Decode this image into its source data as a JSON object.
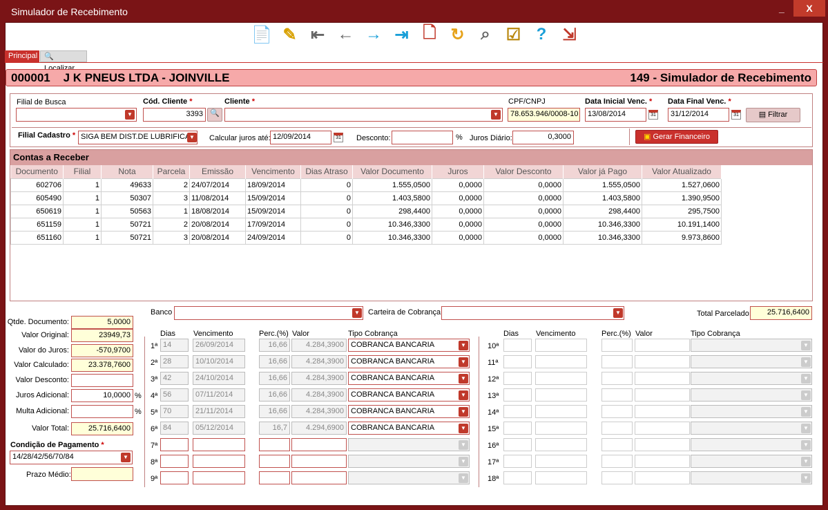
{
  "window": {
    "title": "Simulador de Recebimento",
    "minimize": "_",
    "close": "X"
  },
  "toolbar": [
    {
      "name": "new-icon"
    },
    {
      "name": "edit-icon"
    },
    {
      "name": "first-record-icon"
    },
    {
      "name": "previous-record-icon"
    },
    {
      "name": "next-record-icon"
    },
    {
      "name": "last-record-icon"
    },
    {
      "name": "delete-icon"
    },
    {
      "name": "refresh-icon"
    },
    {
      "name": "search-icon"
    },
    {
      "name": "checklist-icon"
    },
    {
      "name": "help-icon"
    },
    {
      "name": "exit-icon"
    }
  ],
  "tabs": {
    "principal": "Principal",
    "localizar": "Localizar"
  },
  "header": {
    "company": "000001    J K PNEUS LTDA - JOINVILLE",
    "module": "149 - Simulador de Recebimento"
  },
  "filters": {
    "filial_busca_label": "Filial de Busca",
    "filial_busca_value": "",
    "cod_cliente_label": "Cód. Cliente",
    "cod_cliente_value": "3393",
    "cliente_label": "Cliente",
    "cliente_value": "",
    "cpf_label": "CPF/CNPJ",
    "cpf_value": "78.653.946/0008-10",
    "data_inicial_label": "Data Inicial Venc.",
    "data_inicial_value": "13/08/2014",
    "data_final_label": "Data Final Venc.",
    "data_final_value": "31/12/2014",
    "filtrar": "Filtrar",
    "filial_cadastro_label": "Filial Cadastro",
    "filial_cadastro_value": "SIGA BEM DIST.DE LUBRIFICANT",
    "calcular_juros_label": "Calcular juros até:",
    "calcular_juros_value": "12/09/2014",
    "desconto_label": "Desconto:",
    "desconto_value": "",
    "percent": "%",
    "juros_diario_label": "Juros Diário:",
    "juros_diario_value": "0,3000",
    "gerar": "Gerar Financeiro",
    "required_mark": "*"
  },
  "contas": {
    "title": "Contas a Receber",
    "columns": [
      "Documento",
      "Filial",
      "Nota",
      "Parcela",
      "Emissão",
      "Vencimento",
      "Dias Atraso",
      "Valor Documento",
      "Juros",
      "Valor Desconto",
      "Valor já Pago",
      "Valor Atualizado"
    ],
    "rows": [
      [
        "602706",
        "1",
        "49633",
        "2",
        "24/07/2014",
        "18/09/2014",
        "0",
        "1.555,0500",
        "0,0000",
        "0,0000",
        "1.555,0500",
        "1.527,0600"
      ],
      [
        "605490",
        "1",
        "50307",
        "3",
        "11/08/2014",
        "15/09/2014",
        "0",
        "1.403,5800",
        "0,0000",
        "0,0000",
        "1.403,5800",
        "1.390,9500"
      ],
      [
        "650619",
        "1",
        "50563",
        "1",
        "18/08/2014",
        "15/09/2014",
        "0",
        "298,4400",
        "0,0000",
        "0,0000",
        "298,4400",
        "295,7500"
      ],
      [
        "651159",
        "1",
        "50721",
        "2",
        "20/08/2014",
        "17/09/2014",
        "0",
        "10.346,3300",
        "0,0000",
        "0,0000",
        "10.346,3300",
        "10.191,1400"
      ],
      [
        "651160",
        "1",
        "50721",
        "3",
        "20/08/2014",
        "24/09/2014",
        "0",
        "10.346,3300",
        "0,0000",
        "0,0000",
        "10.346,3300",
        "9.973,8600"
      ]
    ]
  },
  "summary": {
    "qtde_label": "Qtde. Documento:",
    "qtde_value": "5,0000",
    "valor_original_label": "Valor Original:",
    "valor_original_value": "23949,73",
    "valor_juros_label": "Valor do Juros:",
    "valor_juros_value": "-570,9700",
    "valor_calculado_label": "Valor Calculado:",
    "valor_calculado_value": "23.378,7600",
    "valor_desconto_label": "Valor Desconto:",
    "valor_desconto_value": "",
    "juros_adicional_label": "Juros Adicional:",
    "juros_adicional_value": "10,0000",
    "multa_adicional_label": "Multa Adicional:",
    "multa_adicional_value": "",
    "valor_total_label": "Valor Total:",
    "valor_total_value": "25.716,6400",
    "condicao_label": "Condição de Pagamento",
    "condicao_value": "14/28/42/56/70/84",
    "prazo_label": "Prazo Médio:",
    "prazo_value": "",
    "percent": "%"
  },
  "parcelas": {
    "banco_label": "Banco",
    "banco_value": "",
    "carteira_label": "Carteira de Cobrança",
    "carteira_value": "",
    "total_parcelado_label": "Total Parcelado:",
    "total_parcelado_value": "25.716,6400",
    "headers": {
      "dias": "Dias",
      "vencimento": "Vencimento",
      "perc": "Perc.(%)",
      "valor": "Valor",
      "tipo": "Tipo Cobrança"
    },
    "left": [
      {
        "n": "1ª",
        "dias": "14",
        "venc": "26/09/2014",
        "perc": "16,66",
        "valor": "4.284,3900",
        "tipo": "COBRANCA BANCARIA"
      },
      {
        "n": "2ª",
        "dias": "28",
        "venc": "10/10/2014",
        "perc": "16,66",
        "valor": "4.284,3900",
        "tipo": "COBRANCA BANCARIA"
      },
      {
        "n": "3ª",
        "dias": "42",
        "venc": "24/10/2014",
        "perc": "16,66",
        "valor": "4.284,3900",
        "tipo": "COBRANCA BANCARIA"
      },
      {
        "n": "4ª",
        "dias": "56",
        "venc": "07/11/2014",
        "perc": "16,66",
        "valor": "4.284,3900",
        "tipo": "COBRANCA BANCARIA"
      },
      {
        "n": "5ª",
        "dias": "70",
        "venc": "21/11/2014",
        "perc": "16,66",
        "valor": "4.284,3900",
        "tipo": "COBRANCA BANCARIA"
      },
      {
        "n": "6ª",
        "dias": "84",
        "venc": "05/12/2014",
        "perc": "16,7",
        "valor": "4.294,6900",
        "tipo": "COBRANCA BANCARIA"
      },
      {
        "n": "7ª",
        "dias": "",
        "venc": "",
        "perc": "",
        "valor": "",
        "tipo": ""
      },
      {
        "n": "8ª",
        "dias": "",
        "venc": "",
        "perc": "",
        "valor": "",
        "tipo": ""
      },
      {
        "n": "9ª",
        "dias": "",
        "venc": "",
        "perc": "",
        "valor": "",
        "tipo": ""
      }
    ],
    "right": [
      {
        "n": "10ª"
      },
      {
        "n": "11ª"
      },
      {
        "n": "12ª"
      },
      {
        "n": "13ª"
      },
      {
        "n": "14ª"
      },
      {
        "n": "15ª"
      },
      {
        "n": "16ª"
      },
      {
        "n": "17ª"
      },
      {
        "n": "18ª"
      }
    ]
  }
}
